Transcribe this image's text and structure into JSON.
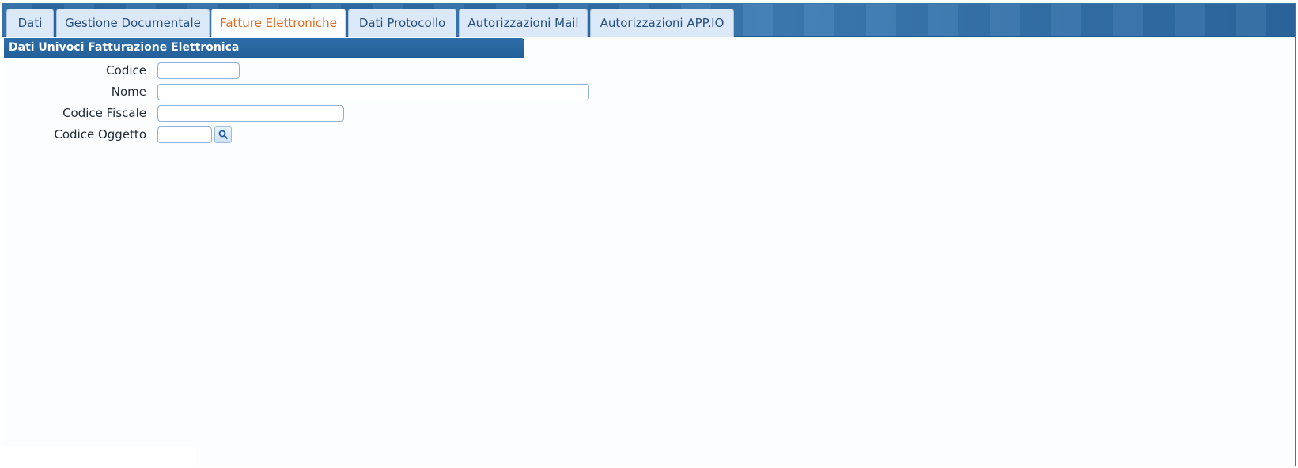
{
  "tabs": [
    {
      "label": "Dati"
    },
    {
      "label": "Gestione Documentale"
    },
    {
      "label": "Fatture Elettroniche",
      "active": true
    },
    {
      "label": "Dati Protocollo"
    },
    {
      "label": "Autorizzazioni Mail"
    },
    {
      "label": "Autorizzazioni APP.IO"
    }
  ],
  "section": {
    "title": "Dati Univoci Fatturazione Elettronica"
  },
  "form": {
    "codice": {
      "label": "Codice",
      "value": ""
    },
    "nome": {
      "label": "Nome",
      "value": ""
    },
    "codice_fiscale": {
      "label": "Codice Fiscale",
      "value": ""
    },
    "codice_oggetto": {
      "label": "Codice Oggetto",
      "value": ""
    }
  },
  "colors": {
    "header_blue": "#2e6ea8",
    "tab_bg": "#dbe8f7",
    "active_tab_text": "#df6d1f",
    "tab_text": "#27507d"
  },
  "icons": {
    "lookup": "search-icon"
  }
}
